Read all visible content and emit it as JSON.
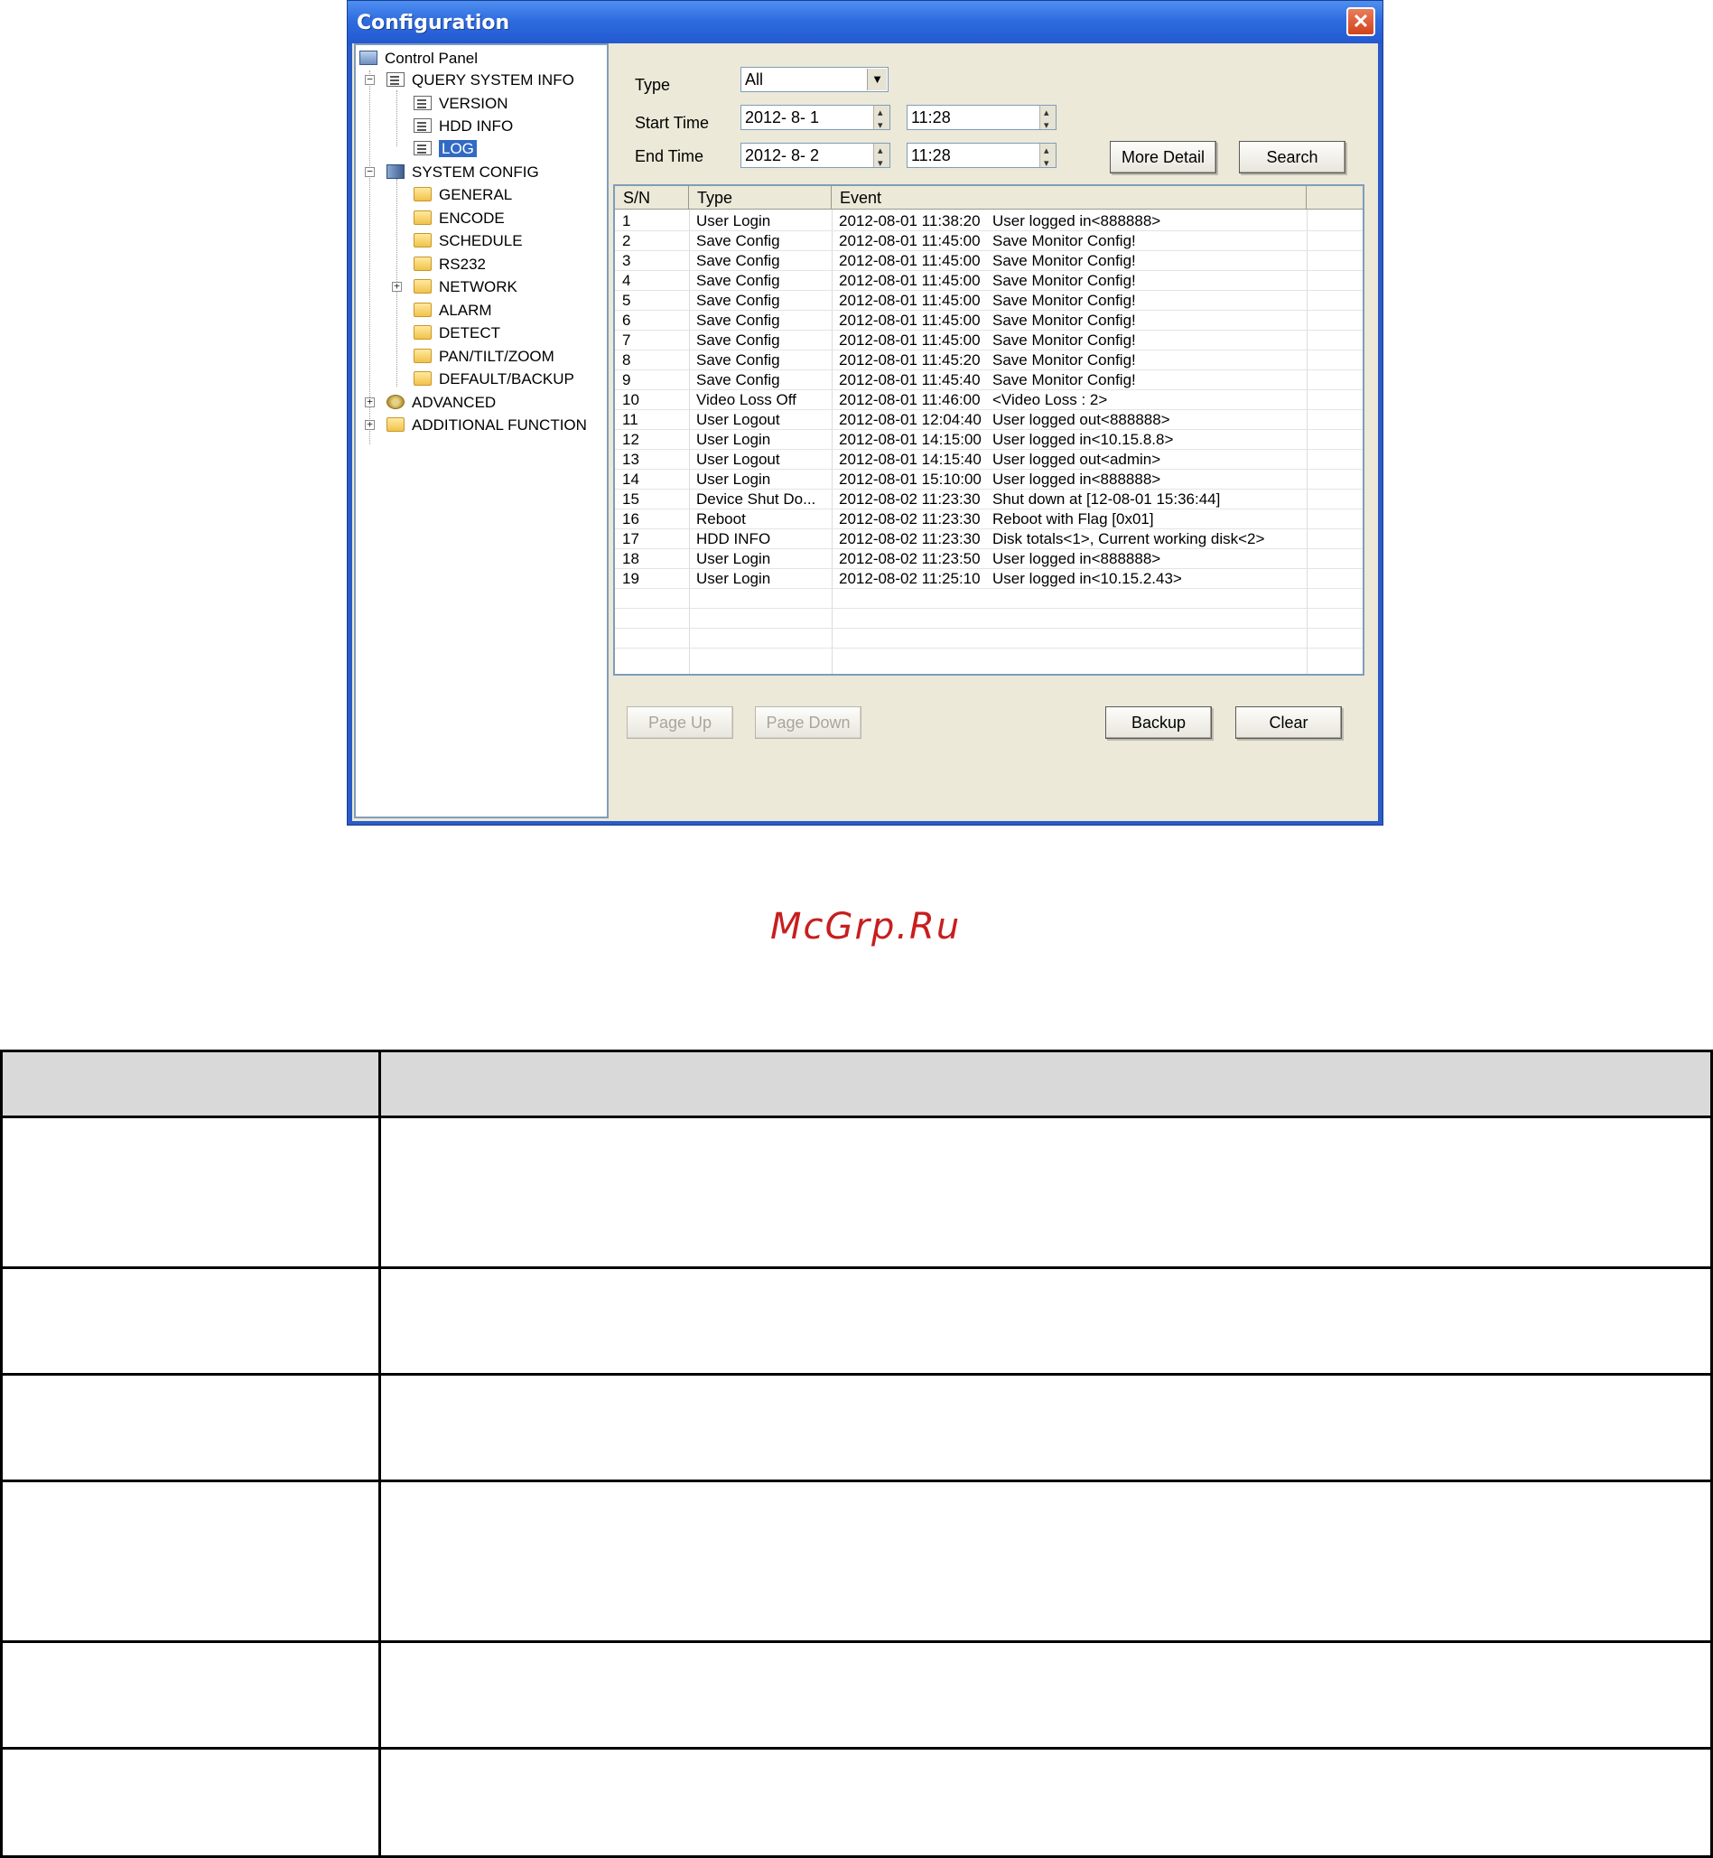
{
  "window": {
    "title": "Configuration",
    "close_label": "✕"
  },
  "tree": {
    "root": "Control Panel",
    "query": "QUERY SYSTEM INFO",
    "version": "VERSION",
    "hdd_info": "HDD INFO",
    "log": "LOG",
    "system_config": "SYSTEM CONFIG",
    "general": "GENERAL",
    "encode": "ENCODE",
    "schedule": "SCHEDULE",
    "rs232": "RS232",
    "network": "NETWORK",
    "alarm": "ALARM",
    "detect": "DETECT",
    "ptz": "PAN/TILT/ZOOM",
    "default_backup": "DEFAULT/BACKUP",
    "advanced": "ADVANCED",
    "additional": "ADDITIONAL FUNCTION",
    "expand_minus": "−",
    "expand_plus": "+"
  },
  "filters": {
    "type_label": "Type",
    "type_value": "All",
    "start_label": "Start Time",
    "start_date": "2012- 8- 1",
    "start_time": "11:28",
    "end_label": "End Time",
    "end_date": "2012- 8- 2",
    "end_time": "11:28",
    "more_detail": "More Detail",
    "search": "Search"
  },
  "log_table": {
    "columns": [
      "S/N",
      "Type",
      "Event"
    ],
    "rows": [
      {
        "sn": "1",
        "type": "User Login",
        "time": "2012-08-01 11:38:20",
        "event": "User logged in<888888>"
      },
      {
        "sn": "2",
        "type": "Save Config",
        "time": "2012-08-01 11:45:00",
        "event": "Save Monitor Config!"
      },
      {
        "sn": "3",
        "type": "Save Config",
        "time": "2012-08-01 11:45:00",
        "event": "Save Monitor Config!"
      },
      {
        "sn": "4",
        "type": "Save Config",
        "time": "2012-08-01 11:45:00",
        "event": "Save Monitor Config!"
      },
      {
        "sn": "5",
        "type": "Save Config",
        "time": "2012-08-01 11:45:00",
        "event": "Save Monitor Config!"
      },
      {
        "sn": "6",
        "type": "Save Config",
        "time": "2012-08-01 11:45:00",
        "event": "Save Monitor Config!"
      },
      {
        "sn": "7",
        "type": "Save Config",
        "time": "2012-08-01 11:45:00",
        "event": "Save Monitor Config!"
      },
      {
        "sn": "8",
        "type": "Save Config",
        "time": "2012-08-01 11:45:20",
        "event": "Save Monitor Config!"
      },
      {
        "sn": "9",
        "type": "Save Config",
        "time": "2012-08-01 11:45:40",
        "event": "Save Monitor Config!"
      },
      {
        "sn": "10",
        "type": "Video Loss Off",
        "time": "2012-08-01 11:46:00",
        "event": "<Video Loss : 2>"
      },
      {
        "sn": "11",
        "type": "User Logout",
        "time": "2012-08-01 12:04:40",
        "event": "User logged out<888888>"
      },
      {
        "sn": "12",
        "type": "User Login",
        "time": "2012-08-01 14:15:00",
        "event": "User logged in<10.15.8.8>"
      },
      {
        "sn": "13",
        "type": "User Logout",
        "time": "2012-08-01 14:15:40",
        "event": "User logged out<admin>"
      },
      {
        "sn": "14",
        "type": "User Login",
        "time": "2012-08-01 15:10:00",
        "event": "User logged in<888888>"
      },
      {
        "sn": "15",
        "type": "Device Shut Do...",
        "time": "2012-08-02 11:23:30",
        "event": "Shut down at [12-08-01 15:36:44]"
      },
      {
        "sn": "16",
        "type": "Reboot",
        "time": "2012-08-02 11:23:30",
        "event": "Reboot with Flag [0x01]"
      },
      {
        "sn": "17",
        "type": "HDD INFO",
        "time": "2012-08-02 11:23:30",
        "event": "Disk totals<1>, Current working disk<2>"
      },
      {
        "sn": "18",
        "type": "User Login",
        "time": "2012-08-02 11:23:50",
        "event": "User logged in<888888>"
      },
      {
        "sn": "19",
        "type": "User Login",
        "time": "2012-08-02 11:25:10",
        "event": "User logged in<10.15.2.43>"
      }
    ]
  },
  "bottom_buttons": {
    "page_up": "Page Up",
    "page_down": "Page Down",
    "backup": "Backup",
    "clear": "Clear"
  },
  "watermark": "McGrp.Ru"
}
